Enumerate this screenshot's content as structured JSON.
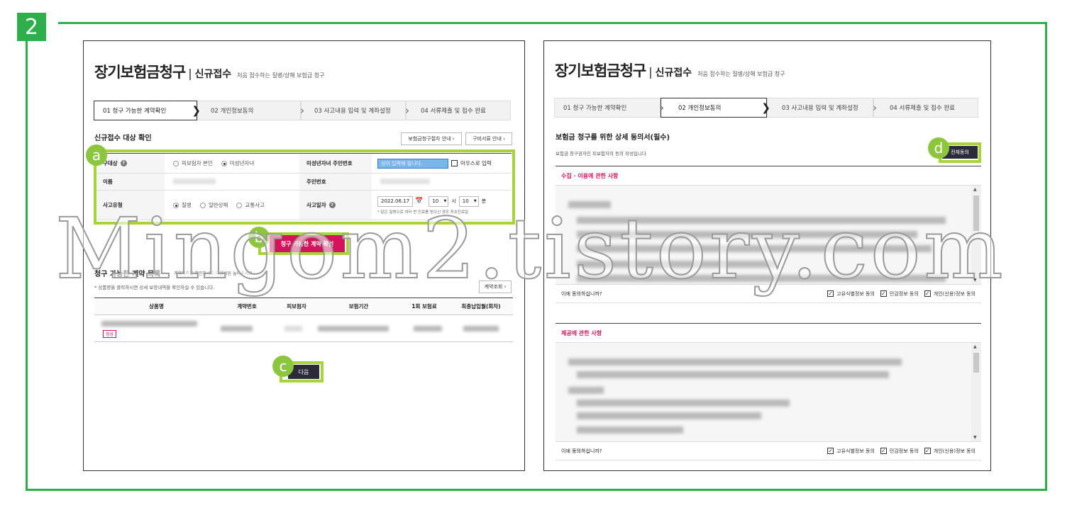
{
  "badge": "2",
  "watermark": "Mingom2.tistory.com",
  "left": {
    "title": "장기보험금청구",
    "subtitle": "신규접수",
    "desc": "처음 접수하는 질병/상해 보험금 청구",
    "steps": [
      "01 청구 가능한 계약확인",
      "02 개인정보동의",
      "03 사고내용 입력 및 계좌설정",
      "04 서류제출 및 접수 완료"
    ],
    "section_title": "신규접수 대상 확인",
    "btn_guide": "보험금청구절차 안내 ›",
    "btn_docs": "구비서류 안내 ›",
    "bubble_a": "a",
    "row1": {
      "label": "구대상",
      "opt1": "피보험자 본인",
      "opt2": "미성년자녀",
      "label2": "미성년자녀 주민번호",
      "input": "성이 입력해 됩니다.",
      "check": "마우스로 입력"
    },
    "row2": {
      "label": "이름",
      "label2": "주민번호"
    },
    "row3": {
      "label": "사고유형",
      "opt1": "질병",
      "opt2": "일반상해",
      "opt3": "교통사고",
      "label2": "사고일자",
      "date": "2022.06.17",
      "hour": "10",
      "hour_unit": "시",
      "min": "10",
      "min_unit": "분",
      "note": "* 같은 질병으로 여러 번 진료를 받으신 경우 최초진료일"
    },
    "bubble_b": "b",
    "confirm_btn": "청구 가능한 계약 확인",
    "list_title": "청구 가능한 계약 목록",
    "list_hint": "계약목록을 확인하시고 다음버튼 눌러주세요.",
    "list_note": "* 상품명을 클릭하시면 상세 보장내역을 확인하실 수 있습니다.",
    "list_btn": "계약조회 ›",
    "columns": [
      "상품명",
      "계약번호",
      "피보험자",
      "보험기간",
      "1회 보험료",
      "최종납입월(회차)"
    ],
    "row_tag": "정상",
    "bubble_c": "c",
    "next_btn": "다음"
  },
  "right": {
    "title": "장기보험금청구",
    "subtitle": "신규접수",
    "desc": "처음 접수하는 질병/상해 보험금 청구",
    "steps": [
      "01 청구 가능한 계약확인",
      "02 개인정보동의",
      "03 사고내용 입력 및 계좌설정",
      "04 서류제출 및 접수 완료"
    ],
    "section_title": "보험금 청구를 위한 상세 동의서(필수)",
    "section_note": "보험금 청구권자인 피보험자의 동의 작성입니다",
    "bubble_d": "d",
    "agree_all_btn": "전체동의",
    "sec1_title": "수집 · 이용에 관한 사항",
    "sec2_title": "제공에 관한 사항",
    "question": "이에 동의하십니까?",
    "check1": "고유식별정보 동의",
    "check2": "민감정보 동의",
    "check3": "개인(신용)정보 동의"
  }
}
